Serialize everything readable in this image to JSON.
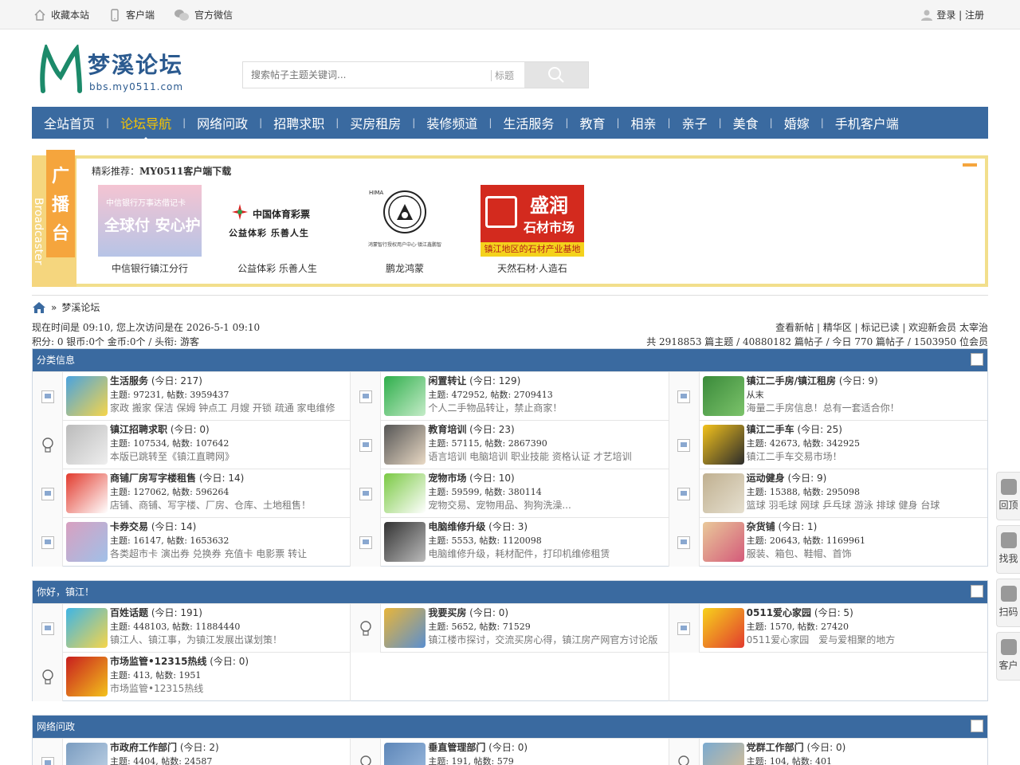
{
  "topbar": {
    "bookmark": "收藏本站",
    "client": "客户端",
    "wechat": "官方微信",
    "login": "登录 | 注册"
  },
  "header": {
    "site_name": "梦溪论坛",
    "site_url": "bbs.my0511.com",
    "search_placeholder": "搜索帖子主题关键词...",
    "search_scope": "标题"
  },
  "nav": {
    "items": [
      "全站首页",
      "论坛导航",
      "网络问政",
      "招聘求职",
      "买房租房",
      "装修频道",
      "生活服务",
      "教育",
      "相亲",
      "亲子",
      "美食",
      "婚嫁",
      "手机客户端"
    ],
    "active": "论坛导航"
  },
  "broadcast": {
    "label": "广播台",
    "label_chars": [
      "广",
      "播",
      "台"
    ],
    "vertical": "Broadcaster",
    "title_prefix": "精彩推荐：",
    "title": "MY0511客户端下载",
    "ads": [
      {
        "caption": "中信银行镇江分行",
        "img_text": "中信银行万事达借记卡",
        "img_text2": "全球付 安心护"
      },
      {
        "caption": "公益体彩 乐善人生",
        "img_text": "中国体育彩票",
        "img_text2": "公益体彩 乐善人生"
      },
      {
        "caption": "鹏龙鸿蒙",
        "img_text": "HIMA",
        "img_text2": "鸿蒙智行授权用户中心·镇江鑫鹏智"
      },
      {
        "caption": "天然石材·人造石",
        "img_text": "盛润",
        "img_text2": "石材市场",
        "img_text3": "镇江地区的石材产业基地"
      }
    ]
  },
  "breadcrumb": {
    "home_sep": "»",
    "current": "梦溪论坛"
  },
  "status": {
    "time_line": "现在时间是 09:10, 您上次访问是在 2026-5-1 09:10",
    "credit_line": "积分: 0 银币:0个 金币:0个 / 头衔: 游客",
    "links_line": "查看新帖 | 精华区 | 标记已读 | 欢迎新会员 太宰治",
    "stats_line": "共 2918853 篇主题 / 40880182 篇帖子 / 今日 770 篇帖子 / 1503950 位会员"
  },
  "categories": [
    {
      "title": "分类信息",
      "rows": [
        [
          {
            "name": "生活服务",
            "today": "(今日: 217)",
            "counts": "主题: 97231, 帖数: 3959437",
            "desc": "家政 搬家 保洁 保姆 钟点工 月嫂 开锁 疏通 家电维修",
            "status": "broken"
          },
          {
            "name": "闲置转让",
            "today": "(今日: 129)",
            "counts": "主题: 472952, 帖数: 2709413",
            "desc": "个人二手物品转让，禁止商家！",
            "status": "broken"
          },
          {
            "name": "镇江二手房/镇江租房",
            "today": "(今日: 9)",
            "counts": "从末",
            "desc": "海量二手房信息！总有一套适合你！",
            "status": "broken"
          }
        ],
        [
          {
            "name": "镇江招聘求职",
            "today": "(今日: 0)",
            "counts": "主题: 107534, 帖数: 107642",
            "desc": "本版已跳转至《镇江直聘网》",
            "status": "bulb"
          },
          {
            "name": "教育培训",
            "today": "(今日: 23)",
            "counts": "主题: 57115, 帖数: 2867390",
            "desc": "语言培训 电脑培训 职业技能 资格认证 才艺培训",
            "status": "broken"
          },
          {
            "name": "镇江二手车",
            "today": "(今日: 25)",
            "counts": "主题: 42673, 帖数: 342925",
            "desc": "镇江二手车交易市场！",
            "status": "broken"
          }
        ],
        [
          {
            "name": "商铺厂房写字楼租售",
            "today": "(今日: 14)",
            "counts": "主题: 127062, 帖数: 596264",
            "desc": "店铺、商铺、写字楼、厂房、仓库、土地租售！",
            "status": "broken"
          },
          {
            "name": "宠物市场",
            "today": "(今日: 10)",
            "counts": "主题: 59599, 帖数: 380114",
            "desc": "宠物交易、宠物用品、狗狗洗澡...",
            "status": "broken"
          },
          {
            "name": "运动健身",
            "today": "(今日: 9)",
            "counts": "主题: 15388, 帖数: 295098",
            "desc": "篮球 羽毛球 网球 乒乓球 游泳 排球 健身 台球",
            "status": "broken"
          }
        ],
        [
          {
            "name": "卡券交易",
            "today": "(今日: 14)",
            "counts": "主题: 16147, 帖数: 1653632",
            "desc": "各类超市卡 演出券 兑换券 充值卡 电影票 转让",
            "status": "broken"
          },
          {
            "name": "电脑维修升级",
            "today": "(今日: 3)",
            "counts": "主题: 5553, 帖数: 1120098",
            "desc": "电脑维修升级，耗材配件，打印机维修租赁",
            "status": "broken"
          },
          {
            "name": "杂货铺",
            "today": "(今日: 1)",
            "counts": "主题: 20643, 帖数: 1169961",
            "desc": "服装、箱包、鞋帽、首饰",
            "status": "broken"
          }
        ]
      ]
    },
    {
      "title": "你好，镇江！",
      "rows": [
        [
          {
            "name": "百姓话题",
            "today": "(今日: 191)",
            "counts": "主题: 448103, 帖数: 11884440",
            "desc": "镇江人、镇江事，为镇江发展出谋划策！",
            "status": "broken"
          },
          {
            "name": "我要买房",
            "today": "(今日: 0)",
            "counts": "主题: 5652, 帖数: 71529",
            "desc": "镇江楼市探讨，交流买房心得，镇江房产网官方讨论版",
            "status": "bulb"
          },
          {
            "name": "0511爱心家园",
            "today": "(今日: 5)",
            "counts": "主题: 1570, 帖数: 27420",
            "desc": "0511爱心家园　爱与爱相聚的地方",
            "status": "broken"
          }
        ],
        [
          {
            "name": "市场监管•12315热线",
            "today": "(今日: 0)",
            "counts": "主题: 413, 帖数: 1951",
            "desc": "市场监管•12315热线",
            "status": "bulb"
          }
        ]
      ]
    },
    {
      "title": "网络问政",
      "rows": [
        [
          {
            "name": "市政府工作部门",
            "today": "(今日: 2)",
            "counts": "主题: 4404, 帖数: 24587",
            "desc": "",
            "status": "broken"
          },
          {
            "name": "垂直管理部门",
            "today": "(今日: 0)",
            "counts": "主题: 191, 帖数: 579",
            "desc": "",
            "status": "bulb"
          },
          {
            "name": "党群工作部门",
            "today": "(今日: 0)",
            "counts": "主题: 104, 帖数: 401",
            "desc": "",
            "status": "bulb"
          }
        ]
      ]
    }
  ],
  "float": [
    {
      "label": "回顶"
    },
    {
      "label": "找我"
    },
    {
      "label": "扫码"
    },
    {
      "label": "客户"
    }
  ],
  "colors": {
    "nav": "#3a6aa0",
    "nav_active": "#f7c400",
    "broadcast_border": "#f2df8c",
    "broadcast_tag": "#f5a53d"
  }
}
